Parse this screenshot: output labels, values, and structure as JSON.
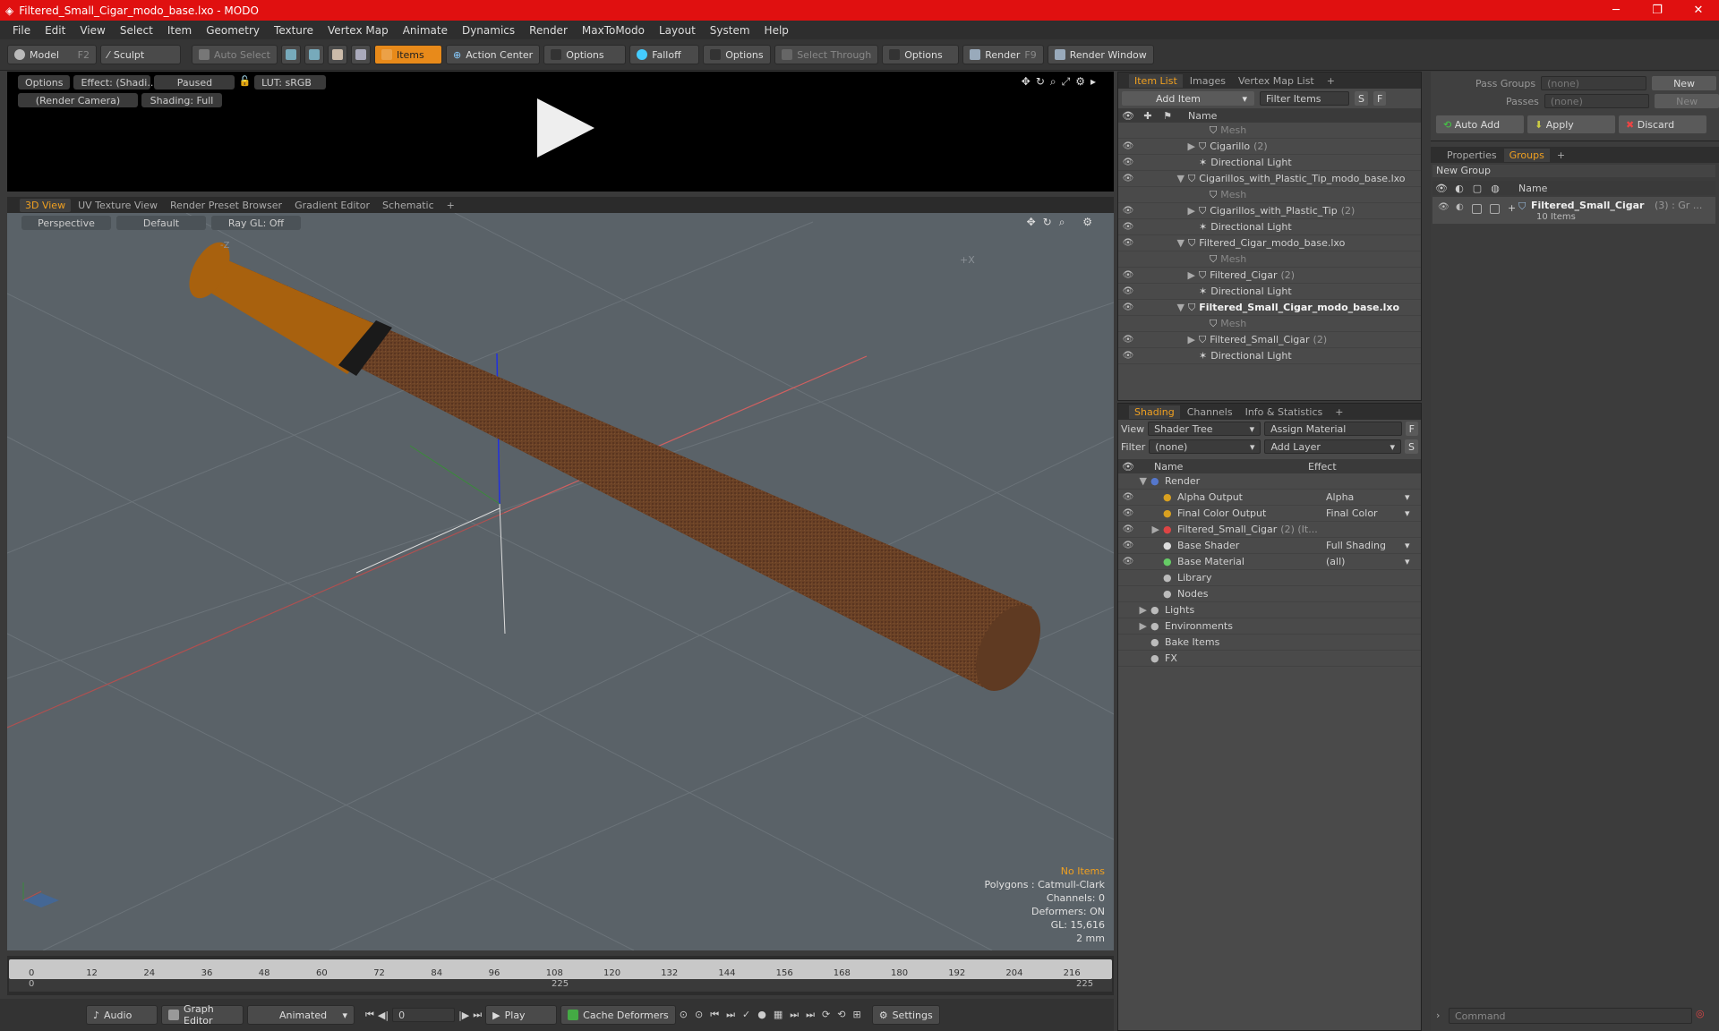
{
  "window": {
    "title": "Filtered_Small_Cigar_modo_base.lxo - MODO"
  },
  "menu": [
    "File",
    "Edit",
    "View",
    "Select",
    "Item",
    "Geometry",
    "Texture",
    "Vertex Map",
    "Animate",
    "Dynamics",
    "Render",
    "MaxToModo",
    "Layout",
    "System",
    "Help"
  ],
  "toolbar": {
    "model": "Model",
    "model_key": "F2",
    "sculpt": "Sculpt",
    "auto_select": "Auto Select",
    "items": "Items",
    "action_center": "Action Center",
    "options1": "Options",
    "falloff": "Falloff",
    "options2": "Options",
    "select_through": "Select Through",
    "options3": "Options",
    "render": "Render",
    "render_key": "F9",
    "render_window": "Render Window"
  },
  "render_preview": {
    "options": "Options",
    "effect": "Effect: (Shadi...",
    "paused": "Paused",
    "lut": "LUT: sRGB",
    "camera": "(Render Camera)",
    "shading": "Shading: Full"
  },
  "viewport_tabs": [
    "3D View",
    "UV Texture View",
    "Render Preset Browser",
    "Gradient Editor",
    "Schematic"
  ],
  "viewport": {
    "perspective": "Perspective",
    "default": "Default",
    "raygl": "Ray GL: Off",
    "stats": {
      "items": "No Items",
      "polygons": "Polygons : Catmull-Clark",
      "channels": "Channels: 0",
      "deformers": "Deformers: ON",
      "gl": "GL: 15,616",
      "scale": "2 mm"
    }
  },
  "timeline": {
    "ticks": [
      "0",
      "12",
      "24",
      "36",
      "48",
      "60",
      "72",
      "84",
      "96",
      "108",
      "120",
      "132",
      "144",
      "156",
      "168",
      "180",
      "192",
      "204",
      "216"
    ],
    "sub_left": "0",
    "sub_mid": "225",
    "sub_right": "225"
  },
  "bottombar": {
    "audio": "Audio",
    "graph_editor": "Graph Editor",
    "animated": "Animated",
    "frame": "0",
    "play": "Play",
    "cache": "Cache Deformers",
    "settings": "Settings"
  },
  "item_list": {
    "tabs": [
      "Item List",
      "Images",
      "Vertex Map List"
    ],
    "add_item": "Add Item",
    "filter": "Filter Items",
    "name_col": "Name",
    "rows": [
      {
        "label": "Mesh",
        "indent": 3,
        "muted": true,
        "arrow": ""
      },
      {
        "label": "Cigarillo",
        "count": "(2)",
        "indent": 2,
        "arrow": "▶"
      },
      {
        "label": "Directional Light",
        "indent": 2,
        "arrow": ""
      },
      {
        "label": "Cigarillos_with_Plastic_Tip_modo_base.lxo",
        "indent": 1,
        "arrow": "▼"
      },
      {
        "label": "Mesh",
        "indent": 3,
        "muted": true,
        "arrow": ""
      },
      {
        "label": "Cigarillos_with_Plastic_Tip",
        "count": "(2)",
        "indent": 2,
        "arrow": "▶"
      },
      {
        "label": "Directional Light",
        "indent": 2,
        "arrow": ""
      },
      {
        "label": "Filtered_Cigar_modo_base.lxo",
        "indent": 1,
        "arrow": "▼"
      },
      {
        "label": "Mesh",
        "indent": 3,
        "muted": true,
        "arrow": ""
      },
      {
        "label": "Filtered_Cigar",
        "count": "(2)",
        "indent": 2,
        "arrow": "▶"
      },
      {
        "label": "Directional Light",
        "indent": 2,
        "arrow": ""
      },
      {
        "label": "Filtered_Small_Cigar_modo_base.lxo",
        "indent": 1,
        "arrow": "▼",
        "bold": true
      },
      {
        "label": "Mesh",
        "indent": 3,
        "muted": true,
        "arrow": ""
      },
      {
        "label": "Filtered_Small_Cigar",
        "count": "(2)",
        "indent": 2,
        "arrow": "▶"
      },
      {
        "label": "Directional Light",
        "indent": 2,
        "arrow": ""
      }
    ]
  },
  "shading": {
    "tabs": [
      "Shading",
      "Channels",
      "Info & Statistics"
    ],
    "view_label": "View",
    "view_value": "Shader Tree",
    "assign": "Assign Material",
    "filter_label": "Filter",
    "filter_value": "(none)",
    "add_layer": "Add Layer",
    "name_col": "Name",
    "effect_col": "Effect",
    "rows": [
      {
        "label": "Render",
        "effect": "",
        "indent": 1,
        "arrow": "▼",
        "eye": false
      },
      {
        "label": "Alpha Output",
        "effect": "Alpha",
        "indent": 2,
        "arrow": "",
        "eye": true
      },
      {
        "label": "Final Color Output",
        "effect": "Final Color",
        "indent": 2,
        "arrow": "",
        "eye": true
      },
      {
        "label": "Filtered_Small_Cigar",
        "extra": "(2) (It...",
        "effect": "",
        "indent": 2,
        "arrow": "▶",
        "eye": true
      },
      {
        "label": "Base Shader",
        "effect": "Full Shading",
        "indent": 2,
        "arrow": "",
        "eye": true
      },
      {
        "label": "Base Material",
        "effect": "(all)",
        "indent": 2,
        "arrow": "",
        "eye": true
      },
      {
        "label": "Library",
        "effect": "",
        "indent": 2,
        "arrow": "",
        "eye": false
      },
      {
        "label": "Nodes",
        "effect": "",
        "indent": 2,
        "arrow": "",
        "eye": false
      },
      {
        "label": "Lights",
        "effect": "",
        "indent": 1,
        "arrow": "▶",
        "eye": false
      },
      {
        "label": "Environments",
        "effect": "",
        "indent": 1,
        "arrow": "▶",
        "eye": false
      },
      {
        "label": "Bake Items",
        "effect": "",
        "indent": 1,
        "arrow": "",
        "eye": false
      },
      {
        "label": "FX",
        "effect": "",
        "indent": 1,
        "arrow": "",
        "eye": false
      }
    ]
  },
  "groups": {
    "pass_groups": "Pass Groups",
    "pass_groups_value": "(none)",
    "new1": "New",
    "passes": "Passes",
    "passes_value": "(none)",
    "new2": "New",
    "auto_add": "Auto Add",
    "apply": "Apply",
    "discard": "Discard",
    "tabs": [
      "Properties",
      "Groups"
    ],
    "new_group": "New Group",
    "name_col": "Name",
    "group_name": "Filtered_Small_Cigar",
    "group_meta": "(3) : Gr ...",
    "group_items": "10 Items",
    "command": "Command"
  }
}
